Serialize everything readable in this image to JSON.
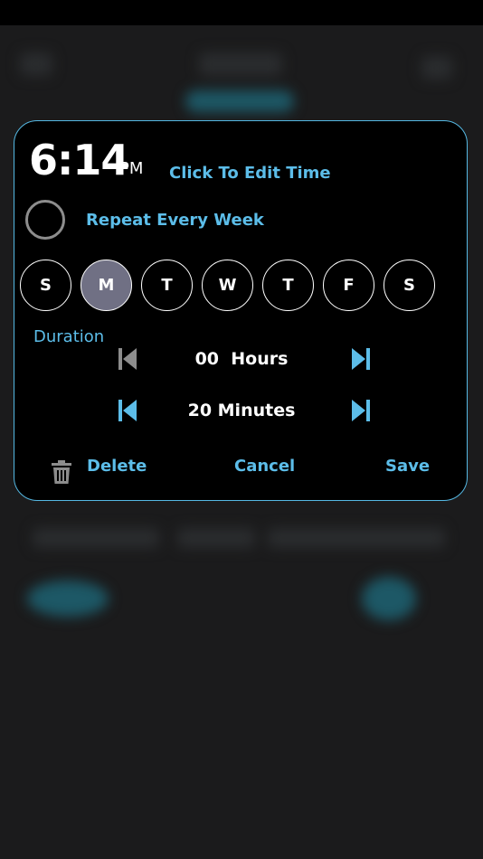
{
  "colors": {
    "accent": "#5cbde9",
    "modal_bg": "#000000",
    "selected_day_bg": "#707084",
    "disabled_icon": "#8d8d8d"
  },
  "alarm": {
    "time": "6:14",
    "ampm": "PM",
    "edit_time_label": "Click To Edit Time"
  },
  "repeat": {
    "label": "Repeat Every Week",
    "checked": false
  },
  "days": [
    {
      "label": "S",
      "selected": false
    },
    {
      "label": "M",
      "selected": true
    },
    {
      "label": "T",
      "selected": false
    },
    {
      "label": "W",
      "selected": false
    },
    {
      "label": "T",
      "selected": false
    },
    {
      "label": "F",
      "selected": false
    },
    {
      "label": "S",
      "selected": false
    }
  ],
  "duration": {
    "label": "Duration",
    "hours": {
      "value_text": "00  Hours",
      "prev_icon": "skip-previous-icon",
      "next_icon": "skip-next-icon",
      "prev_enabled": false
    },
    "minutes": {
      "value_text": "20 Minutes",
      "prev_icon": "skip-previous-icon",
      "next_icon": "skip-next-icon",
      "prev_enabled": true
    }
  },
  "actions": {
    "delete_icon": "trash-icon",
    "delete": "Delete",
    "cancel": "Cancel",
    "save": "Save"
  }
}
